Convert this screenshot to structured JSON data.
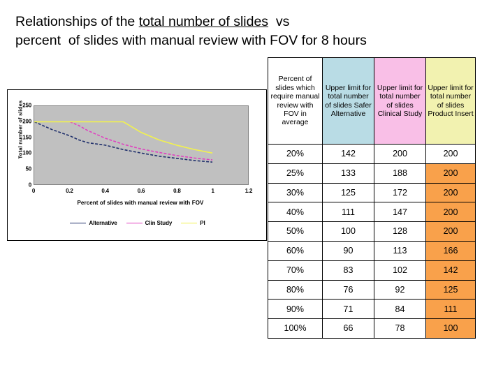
{
  "slide": {
    "title_line1_pre": "Relationships of the ",
    "title_line1_underlined": "total number of slides",
    "title_line1_post": "  vs",
    "title_line2": "percent  of slides with manual review with FOV for 8 hours"
  },
  "table": {
    "headers": [
      "Percent of slides which require manual review with FOV in average",
      "Upper limit for total number of slides Safer Alternative",
      "Upper limit for total number of slides Clinical Study",
      "Upper limit for total number of slides Product Insert"
    ],
    "header_colors": [
      "#ffffff",
      "#b9dce5",
      "#f9bfe7",
      "#f2f2b0"
    ],
    "highlight_color": "#f9a košice",
    "rows": [
      {
        "percent": "20%",
        "alternative": "142",
        "clinical": "200",
        "product_insert": "200",
        "pi_highlight": false
      },
      {
        "percent": "25%",
        "alternative": "133",
        "clinical": "188",
        "product_insert": "200",
        "pi_highlight": true
      },
      {
        "percent": "30%",
        "alternative": "125",
        "clinical": "172",
        "product_insert": "200",
        "pi_highlight": true
      },
      {
        "percent": "40%",
        "alternative": "111",
        "clinical": "147",
        "product_insert": "200",
        "pi_highlight": true
      },
      {
        "percent": "50%",
        "alternative": "100",
        "clinical": "128",
        "product_insert": "200",
        "pi_highlight": true
      },
      {
        "percent": "60%",
        "alternative": "90",
        "clinical": "113",
        "product_insert": "166",
        "pi_highlight": true
      },
      {
        "percent": "70%",
        "alternative": "83",
        "clinical": "102",
        "product_insert": "142",
        "pi_highlight": true
      },
      {
        "percent": "80%",
        "alternative": "76",
        "clinical": "92",
        "product_insert": "125",
        "pi_highlight": true
      },
      {
        "percent": "90%",
        "alternative": "71",
        "clinical": "84",
        "product_insert": "111",
        "pi_highlight": true
      },
      {
        "percent": "100%",
        "alternative": "66",
        "clinical": "78",
        "product_insert": "100",
        "pi_highlight": true
      }
    ]
  },
  "chart_data": {
    "type": "line",
    "title": "",
    "xlabel": "Percent of slides with manual review with FOV",
    "ylabel": "Total number of slides",
    "xlim": [
      0,
      1.2
    ],
    "ylim": [
      0,
      250
    ],
    "xticks": [
      0,
      0.2,
      0.4,
      0.6,
      0.8,
      1,
      1.2
    ],
    "xtick_labels": [
      "0",
      "0.2",
      "0.4",
      "0.6",
      "0.8",
      "1",
      "1.2"
    ],
    "yticks": [
      0,
      50,
      100,
      150,
      200,
      250
    ],
    "ytick_labels": [
      "0",
      "50",
      "100",
      "150",
      "200",
      "250"
    ],
    "grid": false,
    "plot_background": "#c0c0c0",
    "legend_position": "bottom",
    "series": [
      {
        "name": "Alternative",
        "color": "#1f2f6b",
        "dashed": true,
        "x": [
          0,
          0.1,
          0.2,
          0.25,
          0.3,
          0.4,
          0.5,
          0.6,
          0.7,
          0.8,
          0.9,
          1.0
        ],
        "y": [
          200,
          175,
          155,
          142,
          133,
          125,
          111,
          100,
          90,
          83,
          76,
          71,
          66
        ]
      },
      {
        "name": "Clin Study",
        "color": "#e040c0",
        "dashed": true,
        "x": [
          0.2,
          0.25,
          0.3,
          0.4,
          0.5,
          0.6,
          0.7,
          0.8,
          0.9,
          1.0
        ],
        "y": [
          200,
          188,
          172,
          147,
          128,
          113,
          102,
          92,
          84,
          78
        ]
      },
      {
        "name": "PI",
        "color": "#f2f24d",
        "dashed": false,
        "x": [
          0,
          0.2,
          0.3,
          0.4,
          0.5,
          0.6,
          0.7,
          0.8,
          0.9,
          1.0
        ],
        "y": [
          200,
          200,
          200,
          200,
          200,
          166,
          142,
          125,
          111,
          100
        ]
      }
    ]
  }
}
